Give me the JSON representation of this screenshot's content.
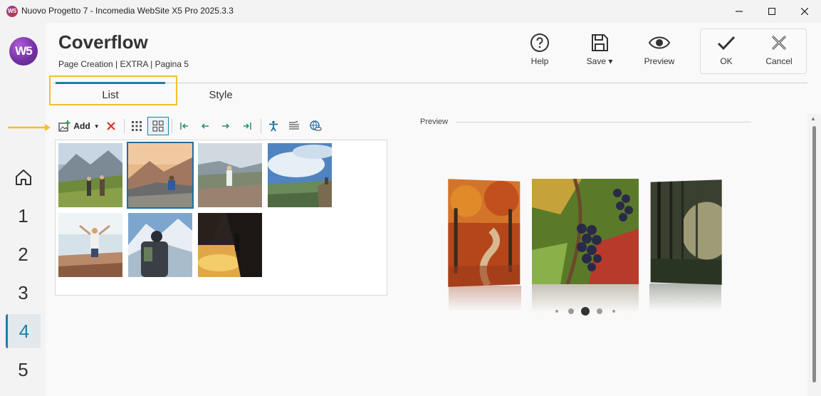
{
  "window": {
    "title": "Nuovo Progetto 7 - Incomedia WebSite X5 Pro 2025.3.3",
    "app_icon_text": "W5"
  },
  "header": {
    "logo_text": "W5",
    "title": "Coverflow",
    "subtitle": "Page Creation | EXTRA | Pagina 5"
  },
  "toolbar": {
    "help_label": "Help",
    "save_label": "Save",
    "preview_label": "Preview",
    "ok_label": "OK",
    "cancel_label": "Cancel"
  },
  "tabs": [
    {
      "label": "List",
      "active": true
    },
    {
      "label": "Style",
      "active": false
    }
  ],
  "sidebar": {
    "items": [
      {
        "label": "home",
        "icon": "home-icon"
      },
      {
        "label": "1"
      },
      {
        "label": "2"
      },
      {
        "label": "3"
      },
      {
        "label": "4",
        "active": true
      },
      {
        "label": "5"
      }
    ]
  },
  "list_toolbar": {
    "add_label": "Add"
  },
  "images": [
    {
      "name": "hikers-meadow",
      "selected": false
    },
    {
      "name": "woman-sitting-mountain",
      "selected": true
    },
    {
      "name": "hiker-cliff",
      "selected": false
    },
    {
      "name": "hiker-sky",
      "selected": false
    },
    {
      "name": "woman-arms-open",
      "selected": false
    },
    {
      "name": "backpacker-snow",
      "selected": false
    },
    {
      "name": "climber-sunset",
      "selected": false
    }
  ],
  "preview": {
    "label": "Preview",
    "slides": [
      "autumn-path",
      "grapes",
      "forest-mist"
    ],
    "dots": 5,
    "active_dot": 3
  },
  "colors": {
    "accent": "#1e7fa8",
    "highlight": "#f2c02e",
    "delete": "#d9342b"
  }
}
